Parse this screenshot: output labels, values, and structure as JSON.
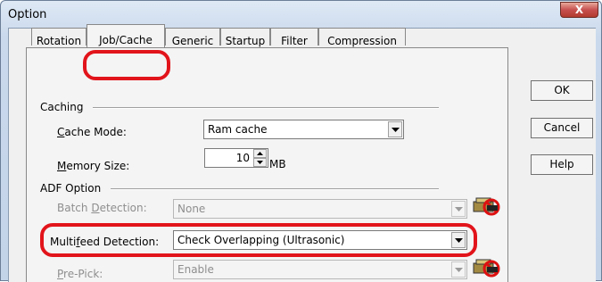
{
  "window": {
    "title": "Option",
    "close_glyph": "X"
  },
  "tabs": [
    {
      "label": "Rotation",
      "u": ""
    },
    {
      "label": "Job/Cache",
      "u": ""
    },
    {
      "label": "Generic",
      "u": ""
    },
    {
      "label": "Startup",
      "u": ""
    },
    {
      "label": "Filter",
      "u": ""
    },
    {
      "label": "Compression",
      "u": ""
    }
  ],
  "caching": {
    "label": "Caching",
    "cache_mode": {
      "label_u": "C",
      "label_rest": "ache Mode:",
      "value": "Ram cache"
    },
    "memory_size": {
      "label_u": "M",
      "label_rest": "emory Size:",
      "value": "10",
      "unit": "MB"
    }
  },
  "adf": {
    "label": "ADF Option",
    "batch_detection": {
      "label_pre": "Batch ",
      "label_u": "D",
      "label_rest": "etection:",
      "value": "None"
    },
    "multifeed_detection": {
      "label_pre": "Multi",
      "label_u": "f",
      "label_rest": "eed Detection:",
      "value": "Check Overlapping (Ultrasonic)"
    },
    "pre_pick": {
      "label_u": "P",
      "label_rest": "re-Pick:",
      "value": "Enable"
    }
  },
  "buttons": {
    "ok": "OK",
    "cancel": "Cancel",
    "help": "Help"
  },
  "colors": {
    "highlight": "#e2141b"
  }
}
